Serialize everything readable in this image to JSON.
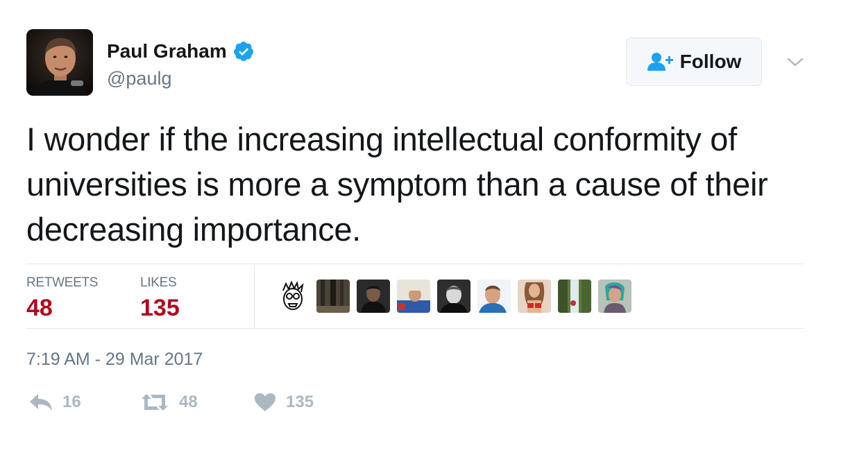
{
  "author": {
    "name": "Paul Graham",
    "handle": "@paulg",
    "verified": true
  },
  "follow_button": {
    "label": "Follow"
  },
  "tweet": {
    "text": "I wonder if the increasing intellectual conformity of universities is more a symptom than a cause of their decreasing importance."
  },
  "stats": {
    "retweets_label": "RETWEETS",
    "retweets_value": "48",
    "likes_label": "LIKES",
    "likes_value": "135"
  },
  "timestamp": "7:19 AM - 29 Mar 2017",
  "actions": {
    "reply_count": "16",
    "retweet_count": "48",
    "like_count": "135"
  },
  "colors": {
    "stat_value": "#b0071e",
    "verified": "#1da1f2",
    "muted": "#657786",
    "action": "#aab8c2"
  }
}
